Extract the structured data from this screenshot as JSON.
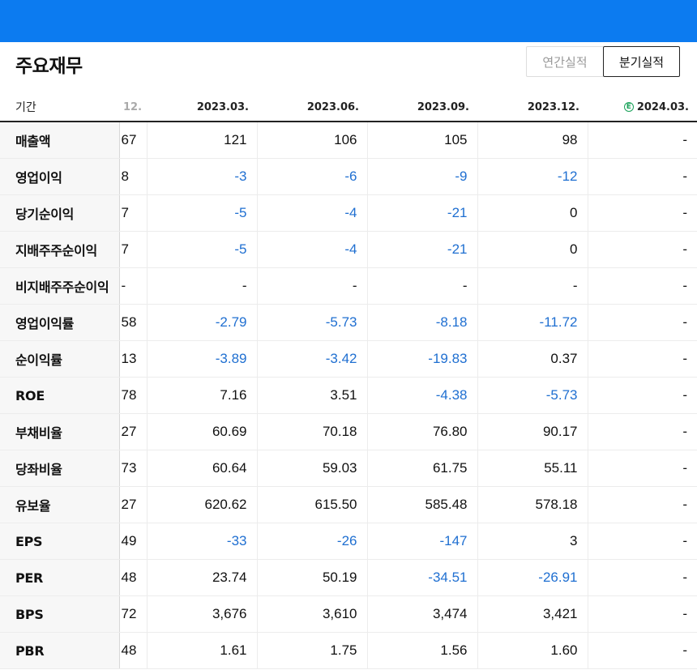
{
  "title": "주요재무",
  "toggle": {
    "annual_label": "연간실적",
    "quarter_label": "분기실적",
    "selected": "quarter"
  },
  "colors": {
    "topbar": "#0c7bf0",
    "negative": "#1f6fd1",
    "estimate": "#1aa25a"
  },
  "table": {
    "period_header": "기간",
    "columns": [
      {
        "label": "12.",
        "partial": true
      },
      {
        "label": "2023.03."
      },
      {
        "label": "2023.06."
      },
      {
        "label": "2023.09."
      },
      {
        "label": "2023.12."
      },
      {
        "label": "2024.03.",
        "estimate_icon": "estimate-circle-e-icon",
        "estimate_mark": "E"
      }
    ],
    "rows": [
      {
        "label": "매출액",
        "values": [
          "67",
          "121",
          "106",
          "105",
          "98",
          "-"
        ]
      },
      {
        "label": "영업이익",
        "values": [
          "8",
          "-3",
          "-6",
          "-9",
          "-12",
          "-"
        ]
      },
      {
        "label": "당기순이익",
        "values": [
          "7",
          "-5",
          "-4",
          "-21",
          "0",
          "-"
        ]
      },
      {
        "label": "지배주주순이익",
        "values": [
          "7",
          "-5",
          "-4",
          "-21",
          "0",
          "-"
        ]
      },
      {
        "label": "비지배주주순이익",
        "values": [
          "-",
          "-",
          "-",
          "-",
          "-",
          "-"
        ]
      },
      {
        "label": "영업이익률",
        "values": [
          "58",
          "-2.79",
          "-5.73",
          "-8.18",
          "-11.72",
          "-"
        ]
      },
      {
        "label": "순이익률",
        "values": [
          "13",
          "-3.89",
          "-3.42",
          "-19.83",
          "0.37",
          "-"
        ]
      },
      {
        "label": "ROE",
        "values": [
          "78",
          "7.16",
          "3.51",
          "-4.38",
          "-5.73",
          "-"
        ]
      },
      {
        "label": "부채비율",
        "values": [
          "27",
          "60.69",
          "70.18",
          "76.80",
          "90.17",
          "-"
        ]
      },
      {
        "label": "당좌비율",
        "values": [
          "73",
          "60.64",
          "59.03",
          "61.75",
          "55.11",
          "-"
        ]
      },
      {
        "label": "유보율",
        "values": [
          "27",
          "620.62",
          "615.50",
          "585.48",
          "578.18",
          "-"
        ]
      },
      {
        "label": "EPS",
        "values": [
          "49",
          "-33",
          "-26",
          "-147",
          "3",
          "-"
        ]
      },
      {
        "label": "PER",
        "values": [
          "48",
          "23.74",
          "50.19",
          "-34.51",
          "-26.91",
          "-"
        ]
      },
      {
        "label": "BPS",
        "values": [
          "72",
          "3,676",
          "3,610",
          "3,474",
          "3,421",
          "-"
        ]
      },
      {
        "label": "PBR",
        "values": [
          "48",
          "1.61",
          "1.75",
          "1.56",
          "1.60",
          "-"
        ]
      }
    ]
  }
}
